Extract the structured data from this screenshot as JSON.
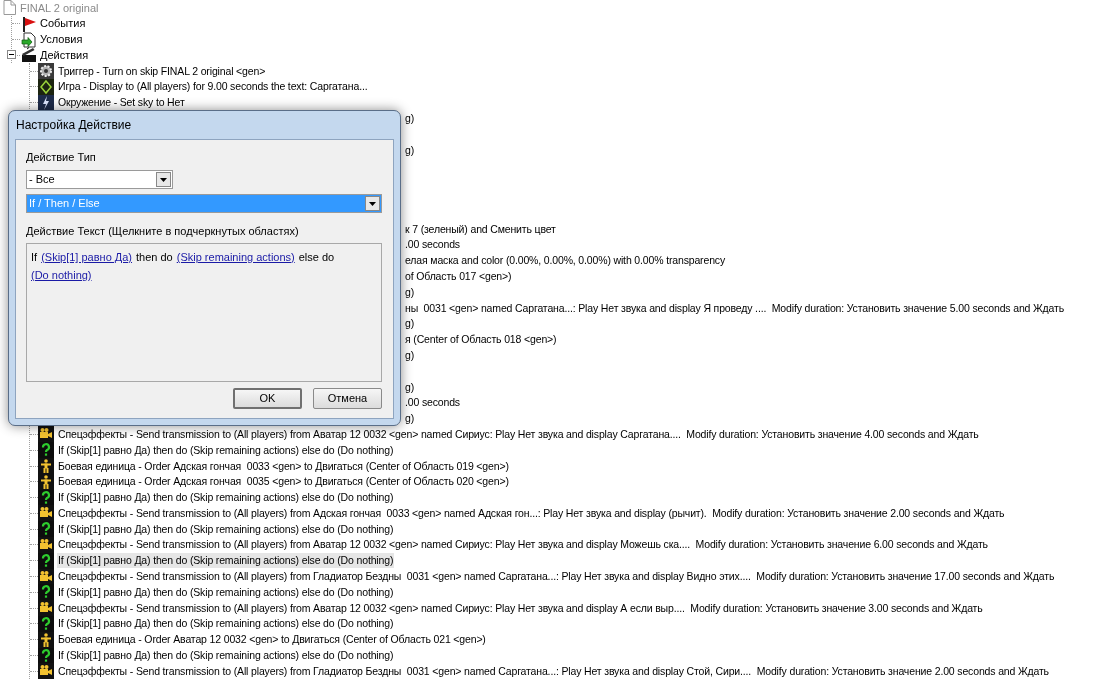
{
  "tree": {
    "root": {
      "label": "FINAL 2 original"
    },
    "sections": [
      {
        "kind": "events",
        "label": "События"
      },
      {
        "kind": "conditions",
        "label": "Условия"
      },
      {
        "kind": "actions",
        "label": "Действия",
        "expanded": true
      }
    ],
    "actions": [
      {
        "kind": "trigger",
        "selected": false,
        "text": "Триггер - Turn on skip FINAL 2 original <gen>"
      },
      {
        "kind": "game",
        "selected": false,
        "text": "Игра - Display to (All players) for 9.00 seconds the text: Саргатана..."
      },
      {
        "kind": "environment",
        "selected": false,
        "text": "Окружение - Set sky to Нет"
      },
      {
        "kind": "covered",
        "selected": false,
        "text": "g)"
      },
      {
        "kind": "hidden"
      },
      {
        "kind": "covered",
        "selected": false,
        "text": "g)"
      },
      {
        "kind": "hidden"
      },
      {
        "kind": "hidden"
      },
      {
        "kind": "hidden"
      },
      {
        "kind": "hidden"
      },
      {
        "kind": "covered",
        "selected": false,
        "text": "к 7 (зеленый) and Сменить цвет"
      },
      {
        "kind": "covered",
        "selected": false,
        "text": ".00 seconds"
      },
      {
        "kind": "covered",
        "selected": false,
        "text": "елая маска and color (0.00%, 0.00%, 0.00%) with 0.00% transparency"
      },
      {
        "kind": "covered",
        "selected": false,
        "text": "of Область 017 <gen>)"
      },
      {
        "kind": "covered",
        "selected": false,
        "text": "g)"
      },
      {
        "kind": "covered",
        "selected": false,
        "text": "ны  0031 <gen> named Саргатана...: Play Нет звука and display Я проведу ....  Modify duration: Установить значение 5.00 seconds and Ждать"
      },
      {
        "kind": "covered",
        "selected": false,
        "text": "g)"
      },
      {
        "kind": "covered",
        "selected": false,
        "text": "я (Center of Область 018 <gen>)"
      },
      {
        "kind": "covered",
        "selected": false,
        "text": "g)"
      },
      {
        "kind": "hidden"
      },
      {
        "kind": "covered",
        "selected": false,
        "text": "g)"
      },
      {
        "kind": "covered",
        "selected": false,
        "text": ".00 seconds"
      },
      {
        "kind": "covered",
        "selected": false,
        "text": "g)"
      },
      {
        "kind": "effects",
        "selected": false,
        "text": "Спецэффекты - Send transmission to (All players) from Аватар 12 0032 <gen> named Сириус: Play Нет звука and display Саргатана....  Modify duration: Установить значение 4.00 seconds and Ждать"
      },
      {
        "kind": "condition",
        "selected": false,
        "text": "If (Skip[1] равно Да) then do (Skip remaining actions) else do (Do nothing)"
      },
      {
        "kind": "unit",
        "selected": false,
        "text": "Боевая единица - Order Адская гончая  0033 <gen> to Двигаться (Center of Область 019 <gen>)"
      },
      {
        "kind": "unit",
        "selected": false,
        "text": "Боевая единица - Order Адская гончая  0035 <gen> to Двигаться (Center of Область 020 <gen>)"
      },
      {
        "kind": "condition",
        "selected": false,
        "text": "If (Skip[1] равно Да) then do (Skip remaining actions) else do (Do nothing)"
      },
      {
        "kind": "effects",
        "selected": false,
        "text": "Спецэффекты - Send transmission to (All players) from Адская гончая  0033 <gen> named Адская гон...: Play Нет звука and display (рычит).  Modify duration: Установить значение 2.00 seconds and Ждать"
      },
      {
        "kind": "condition",
        "selected": false,
        "text": "If (Skip[1] равно Да) then do (Skip remaining actions) else do (Do nothing)"
      },
      {
        "kind": "effects",
        "selected": false,
        "text": "Спецэффекты - Send transmission to (All players) from Аватар 12 0032 <gen> named Сириус: Play Нет звука and display Можешь ска....  Modify duration: Установить значение 6.00 seconds and Ждать"
      },
      {
        "kind": "condition",
        "selected": true,
        "text": "If (Skip[1] равно Да) then do (Skip remaining actions) else do (Do nothing)"
      },
      {
        "kind": "effects",
        "selected": false,
        "text": "Спецэффекты - Send transmission to (All players) from Гладиатор Бездны  0031 <gen> named Саргатана...: Play Нет звука and display Видно этих....  Modify duration: Установить значение 17.00 seconds and Ждать"
      },
      {
        "kind": "condition",
        "selected": false,
        "text": "If (Skip[1] равно Да) then do (Skip remaining actions) else do (Do nothing)"
      },
      {
        "kind": "effects",
        "selected": false,
        "text": "Спецэффекты - Send transmission to (All players) from Аватар 12 0032 <gen> named Сириус: Play Нет звука and display А если выр....  Modify duration: Установить значение 3.00 seconds and Ждать"
      },
      {
        "kind": "condition",
        "selected": false,
        "text": "If (Skip[1] равно Да) then do (Skip remaining actions) else do (Do nothing)"
      },
      {
        "kind": "unit",
        "selected": false,
        "text": "Боевая единица - Order Аватар 12 0032 <gen> to Двигаться (Center of Область 021 <gen>)"
      },
      {
        "kind": "condition",
        "selected": false,
        "text": "If (Skip[1] равно Да) then do (Skip remaining actions) else do (Do nothing)"
      },
      {
        "kind": "effects",
        "selected": false,
        "text": "Спецэффекты - Send transmission to (All players) from Гладиатор Бездны  0031 <gen> named Саргатана...: Play Нет звука and display Стой, Сири....  Modify duration: Установить значение 2.00 seconds and Ждать"
      }
    ]
  },
  "dialog": {
    "title": "Настройка Действие",
    "type_label": "Действие Тип",
    "category_select": {
      "value": "- Все",
      "focused": false
    },
    "action_select": {
      "value": "If / Then / Else",
      "focused": true
    },
    "text_label": "Действие Текст (Щелкните в подчеркнутых областях)",
    "action_text": [
      {
        "kind": "text",
        "text": "If"
      },
      {
        "kind": "link",
        "text": "(Skip[1] равно Да)"
      },
      {
        "kind": "text",
        "text": "then do"
      },
      {
        "kind": "link",
        "text": "(Skip remaining actions)"
      },
      {
        "kind": "text",
        "text": "else do"
      },
      {
        "kind": "link",
        "text": "(Do nothing)"
      }
    ],
    "buttons": [
      {
        "label": "OK",
        "default": true
      },
      {
        "label": "Отмена",
        "default": false
      }
    ]
  }
}
